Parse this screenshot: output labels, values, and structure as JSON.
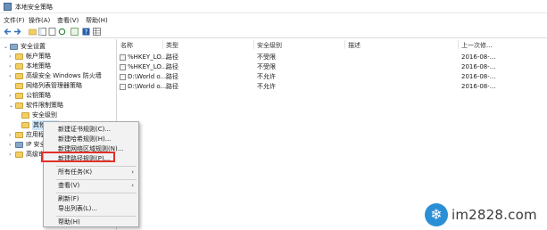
{
  "window": {
    "title": "本地安全策略"
  },
  "menu": [
    "文件(F)",
    "操作(A)",
    "查看(V)",
    "帮助(H)"
  ],
  "tree": {
    "items": [
      {
        "label": "安全设置",
        "arrow": "⌄"
      },
      {
        "label": "帐户策略",
        "arrow": "›"
      },
      {
        "label": "本地策略",
        "arrow": "›"
      },
      {
        "label": "高级安全 Windows 防火墙",
        "arrow": "›"
      },
      {
        "label": "网络列表管理器策略",
        "arrow": ""
      },
      {
        "label": "公钥策略",
        "arrow": "›"
      },
      {
        "label": "软件限制策略",
        "arrow": "⌄"
      },
      {
        "label": "安全级别",
        "arrow": ""
      },
      {
        "label": "其他规则",
        "arrow": ""
      },
      {
        "label": "应用程",
        "arrow": "›"
      },
      {
        "label": "IP 安全",
        "arrow": "›"
      },
      {
        "label": "高级审",
        "arrow": "›"
      }
    ]
  },
  "list": {
    "columns": [
      "名称",
      "类型",
      "安全级别",
      "描述",
      "上一次修..."
    ],
    "rows": [
      {
        "name": "%HKEY_LO...",
        "type": "路径",
        "level": "不受限",
        "desc": "",
        "date": "2016-08-..."
      },
      {
        "name": "%HKEY_LO...",
        "type": "路径",
        "level": "不受限",
        "desc": "",
        "date": "2016-08-..."
      },
      {
        "name": "D:\\World o...",
        "type": "路径",
        "level": "不允许",
        "desc": "",
        "date": "2016-08-..."
      },
      {
        "name": "D:\\World o...",
        "type": "路径",
        "level": "不允许",
        "desc": "",
        "date": "2016-08-..."
      }
    ]
  },
  "context_menu": {
    "items": [
      {
        "label": "新建证书规则(C)...",
        "submenu": ""
      },
      {
        "label": "新建哈希规则(H)...",
        "submenu": ""
      },
      {
        "label": "新建网络区域规则(N)...",
        "submenu": ""
      },
      {
        "label": "新建路径规则(P)...",
        "submenu": ""
      },
      {
        "label": "所有任务(K)",
        "submenu": "›"
      },
      {
        "label": "查看(V)",
        "submenu": "›"
      },
      {
        "label": "刷新(F)",
        "submenu": ""
      },
      {
        "label": "导出列表(L)...",
        "submenu": ""
      },
      {
        "label": "帮助(H)",
        "submenu": ""
      }
    ],
    "highlighted_color": "#e0302a"
  },
  "watermark": {
    "text": "im2828.com"
  }
}
